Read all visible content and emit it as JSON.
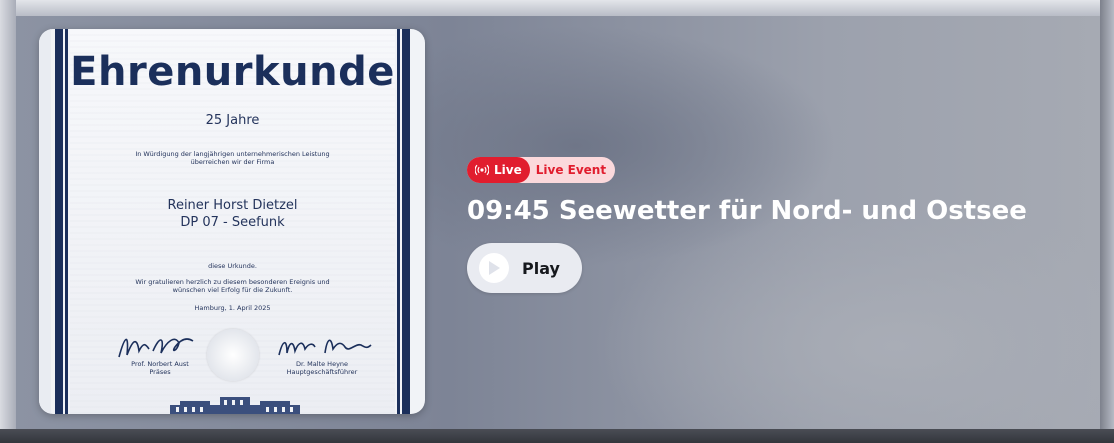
{
  "cover": {
    "title": "Ehrenurkunde",
    "years": "25 Jahre",
    "intro_line1": "In Würdigung der langjährigen unternehmerischen Leistung",
    "intro_line2": "überreichen wir der Firma",
    "name_line1": "Reiner Horst Dietzel",
    "name_line2": "DP 07 - Seefunk",
    "urkunde": "diese Urkunde.",
    "congrats_line1": "Wir gratulieren herzlich zu diesem besonderen Ereignis und",
    "congrats_line2": "wünschen viel Erfolg für die Zukunft.",
    "date": "Hamburg, 1. April 2025",
    "signer_left_name": "Prof. Norbert Aust",
    "signer_left_role": "Präses",
    "signer_right_name": "Dr. Malte Heyne",
    "signer_right_role": "Hauptgeschäftsführer"
  },
  "live": {
    "badge_label": "Live",
    "event_label": "Live Event",
    "icon": "broadcast-icon",
    "color": "#e11d2e"
  },
  "headline": "09:45 Seewetter für Nord- und Ostsee",
  "play": {
    "label": "Play",
    "icon": "play-icon"
  }
}
